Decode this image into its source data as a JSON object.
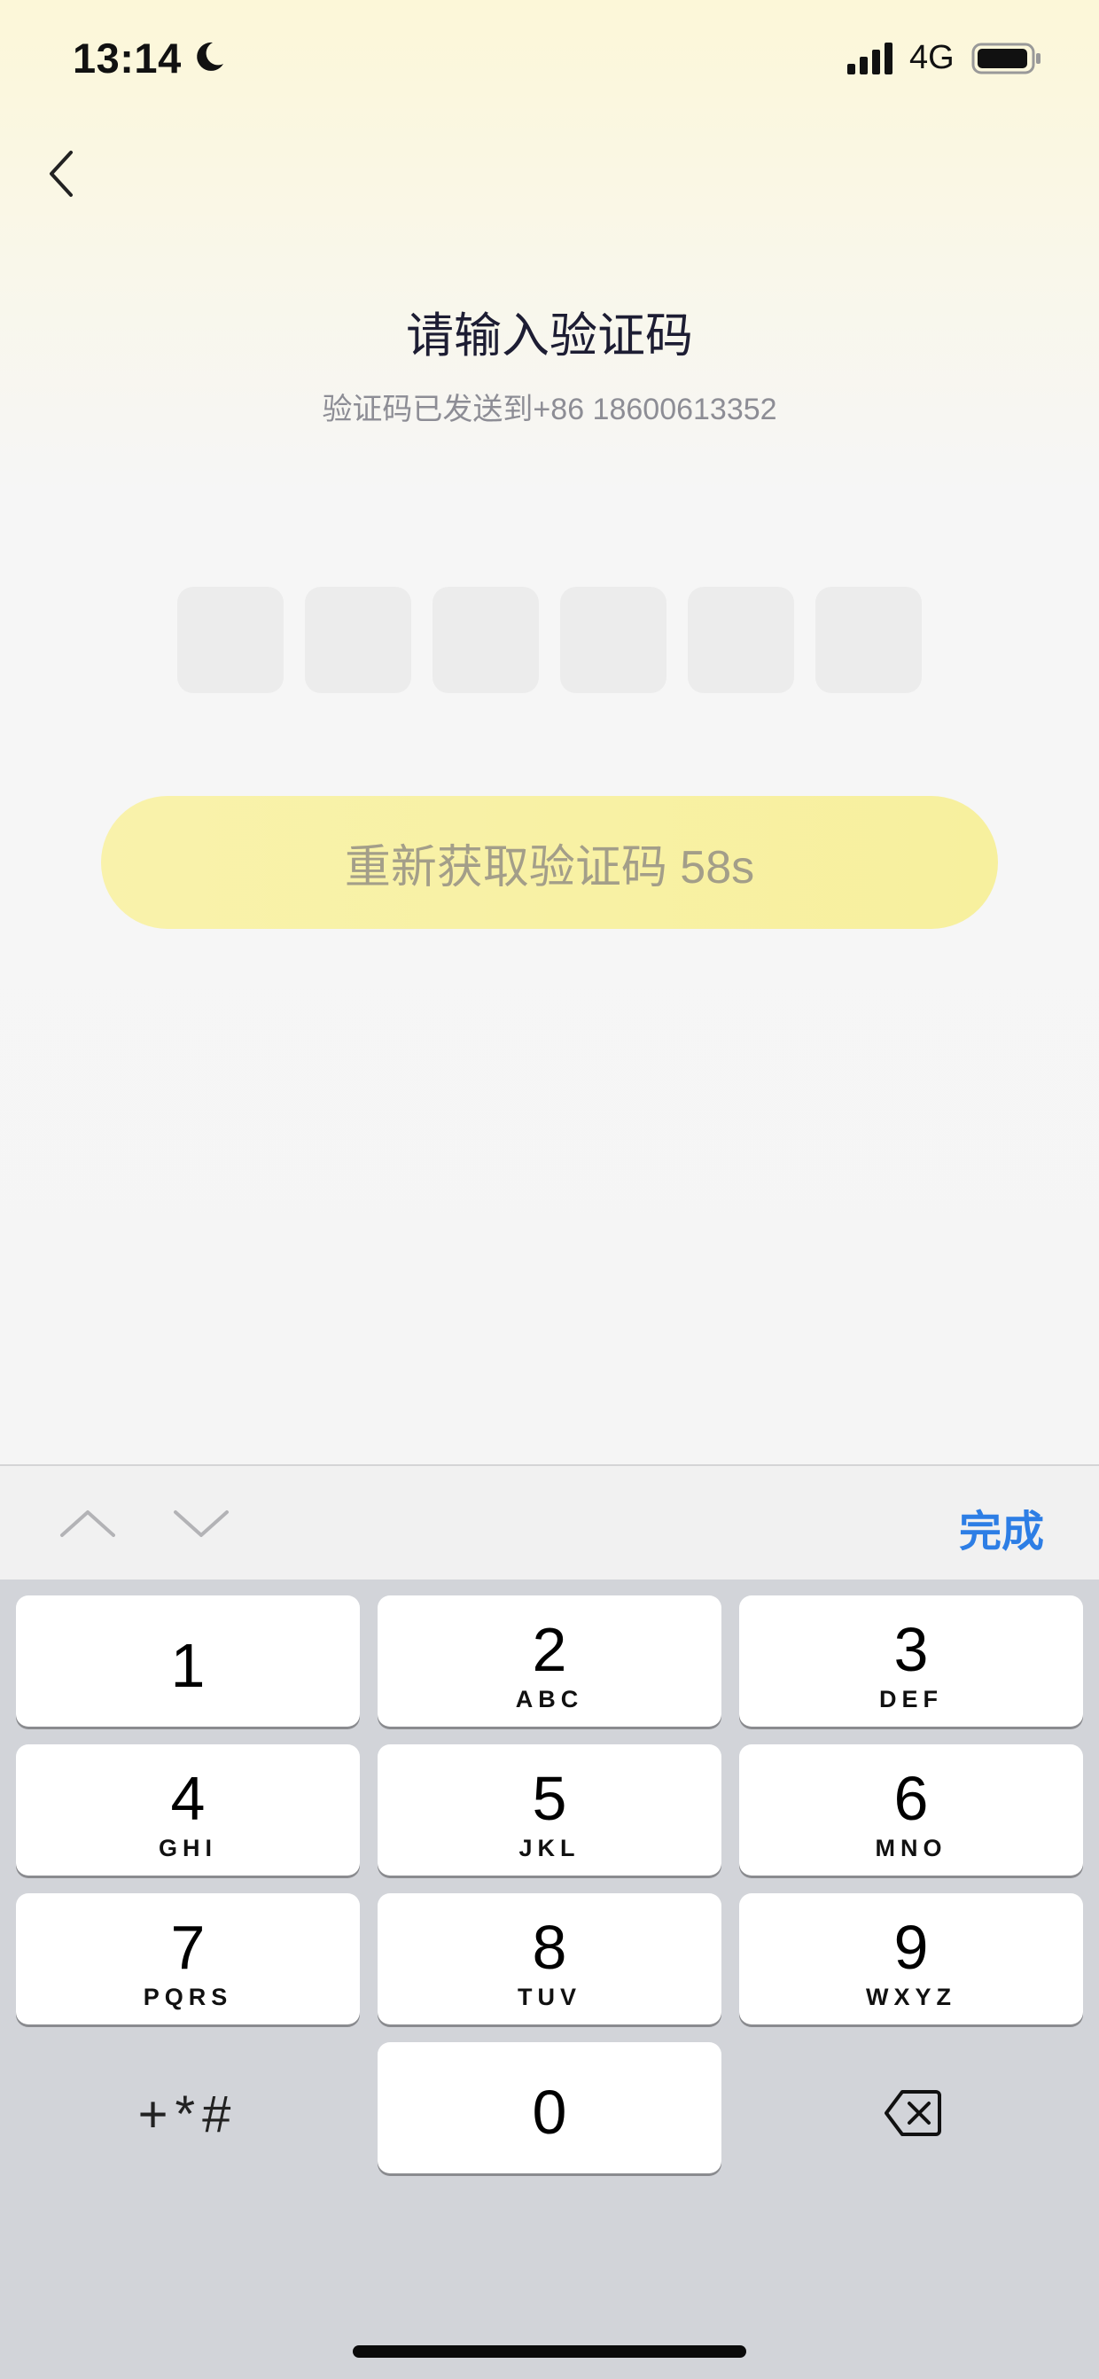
{
  "status_bar": {
    "time": "13:14",
    "network": "4G",
    "icons": [
      "moon-icon",
      "signal-icon",
      "battery-icon"
    ]
  },
  "header": {
    "back_icon": "chevron-left-icon",
    "title": "请输入验证码",
    "subtitle": "验证码已发送到+86 18600613352"
  },
  "code_input": {
    "digit_count": 6,
    "values": [
      "",
      "",
      "",
      "",
      "",
      ""
    ]
  },
  "resend_button": {
    "label": "重新获取验证码 58s"
  },
  "keyboard_toolbar": {
    "prev_icon": "chevron-up-icon",
    "next_icon": "chevron-down-icon",
    "done_label": "完成"
  },
  "keypad": {
    "keys": [
      {
        "num": "1",
        "letters": ""
      },
      {
        "num": "2",
        "letters": "ABC"
      },
      {
        "num": "3",
        "letters": "DEF"
      },
      {
        "num": "4",
        "letters": "GHI"
      },
      {
        "num": "5",
        "letters": "JKL"
      },
      {
        "num": "6",
        "letters": "MNO"
      },
      {
        "num": "7",
        "letters": "PQRS"
      },
      {
        "num": "8",
        "letters": "TUV"
      },
      {
        "num": "9",
        "letters": "WXYZ"
      },
      {
        "num": "0",
        "letters": ""
      }
    ],
    "symbols_label": "+*#",
    "delete_icon": "backspace-icon"
  },
  "colors": {
    "accent": "#2d7ee5",
    "button_bg": "#f8f1a4",
    "button_text": "#a39e89",
    "title": "#1d1d33"
  }
}
